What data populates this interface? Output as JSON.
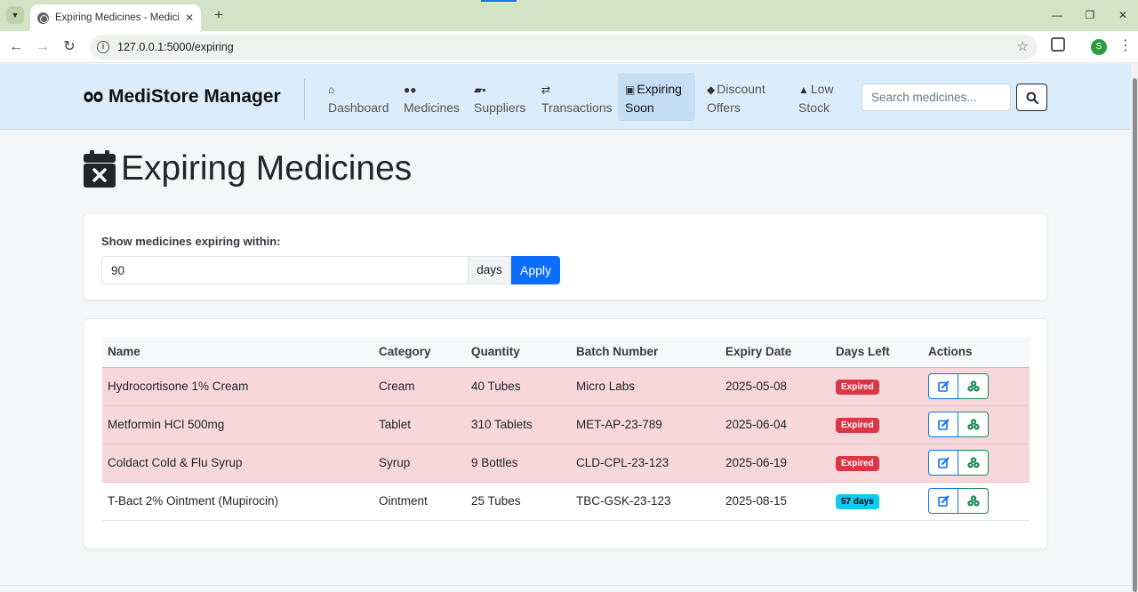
{
  "browser": {
    "tab_title": "Expiring Medicines - Medicine S",
    "url": "127.0.0.1:5000/expiring",
    "profile_initial": "S"
  },
  "navbar": {
    "brand": "MediStore Manager",
    "items": [
      {
        "label": "Dashboard",
        "icon": "home-icon"
      },
      {
        "label": "Medicines",
        "icon": "pills-icon"
      },
      {
        "label": "Suppliers",
        "icon": "truck-icon"
      },
      {
        "label": "Transactions",
        "icon": "exchange-icon"
      },
      {
        "label": "Expiring Soon",
        "icon": "calendar-x-icon",
        "active": true
      },
      {
        "label": "Discount Offers",
        "icon": "tags-icon"
      },
      {
        "label": "Low Stock",
        "icon": "warning-icon"
      }
    ],
    "search_placeholder": "Search medicines..."
  },
  "page": {
    "title": "Expiring Medicines"
  },
  "filter": {
    "label": "Show medicines expiring within:",
    "value": "90",
    "addon": "days",
    "button": "Apply"
  },
  "table": {
    "headers": [
      "Name",
      "Category",
      "Quantity",
      "Batch Number",
      "Expiry Date",
      "Days Left",
      "Actions"
    ],
    "rows": [
      {
        "name": "Hydrocortisone 1% Cream",
        "category": "Cream",
        "quantity": "40 Tubes",
        "batch": "Micro Labs",
        "expiry": "2025-05-08",
        "days_left": "Expired",
        "status": "expired"
      },
      {
        "name": "Metformin HCl 500mg",
        "category": "Tablet",
        "quantity": "310 Tablets",
        "batch": "MET-AP-23-789",
        "expiry": "2025-06-04",
        "days_left": "Expired",
        "status": "expired"
      },
      {
        "name": "Coldact Cold & Flu Syrup",
        "category": "Syrup",
        "quantity": "9 Bottles",
        "batch": "CLD-CPL-23-123",
        "expiry": "2025-06-19",
        "days_left": "Expired",
        "status": "expired"
      },
      {
        "name": "T-Bact 2% Ointment (Mupirocin)",
        "category": "Ointment",
        "quantity": "25 Tubes",
        "batch": "TBC-GSK-23-123",
        "expiry": "2025-08-15",
        "days_left": "57 days",
        "status": "soon"
      }
    ]
  },
  "colors": {
    "navbar_bg": "#dbecfb",
    "expired_row": "#f8d7da",
    "danger": "#dc3545",
    "info": "#0dcaf0",
    "primary": "#0d6efd",
    "success": "#198754"
  }
}
